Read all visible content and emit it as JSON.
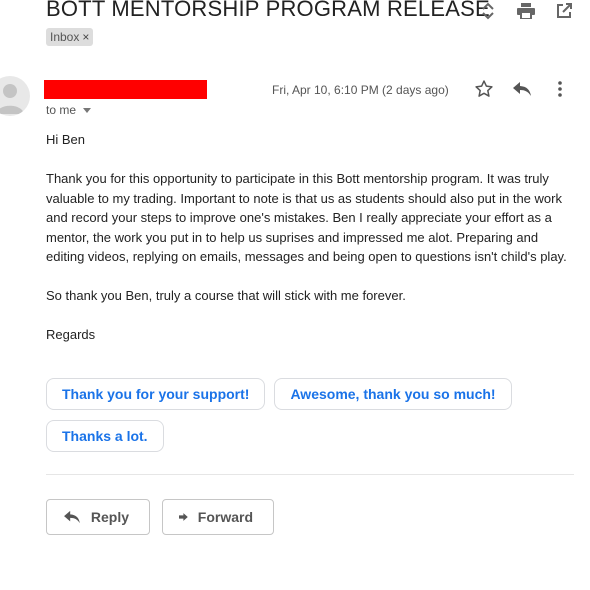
{
  "header": {
    "subject": "BOTT MENTORSHIP PROGRAM RELEASE",
    "label_chip": "Inbox",
    "label_remove": "×"
  },
  "message": {
    "recipient": "to me",
    "date": "Fri, Apr 10, 6:10 PM (2 days ago)",
    "body": {
      "greeting": "Hi Ben",
      "paragraph1": "Thank you for this opportunity to participate in this Bott mentorship program. It was truly valuable to my trading. Important to note is that us as  students should also put in the work and record your steps to improve one's mistakes. Ben I really appreciate your effort as a mentor, the work you put in to help us suprises and impressed me alot. Preparing and editing videos, replying on emails, messages and being open to questions isn't child's play.",
      "paragraph2": "So thank you Ben, truly a course that will stick with me forever.",
      "closing": "Regards"
    }
  },
  "smart_replies": [
    "Thank you for your support!",
    "Awesome, thank you so much!",
    "Thanks a lot."
  ],
  "actions": {
    "reply": "Reply",
    "forward": "Forward"
  },
  "colors": {
    "accent": "#1a73e8",
    "redaction": "#ff0000"
  }
}
